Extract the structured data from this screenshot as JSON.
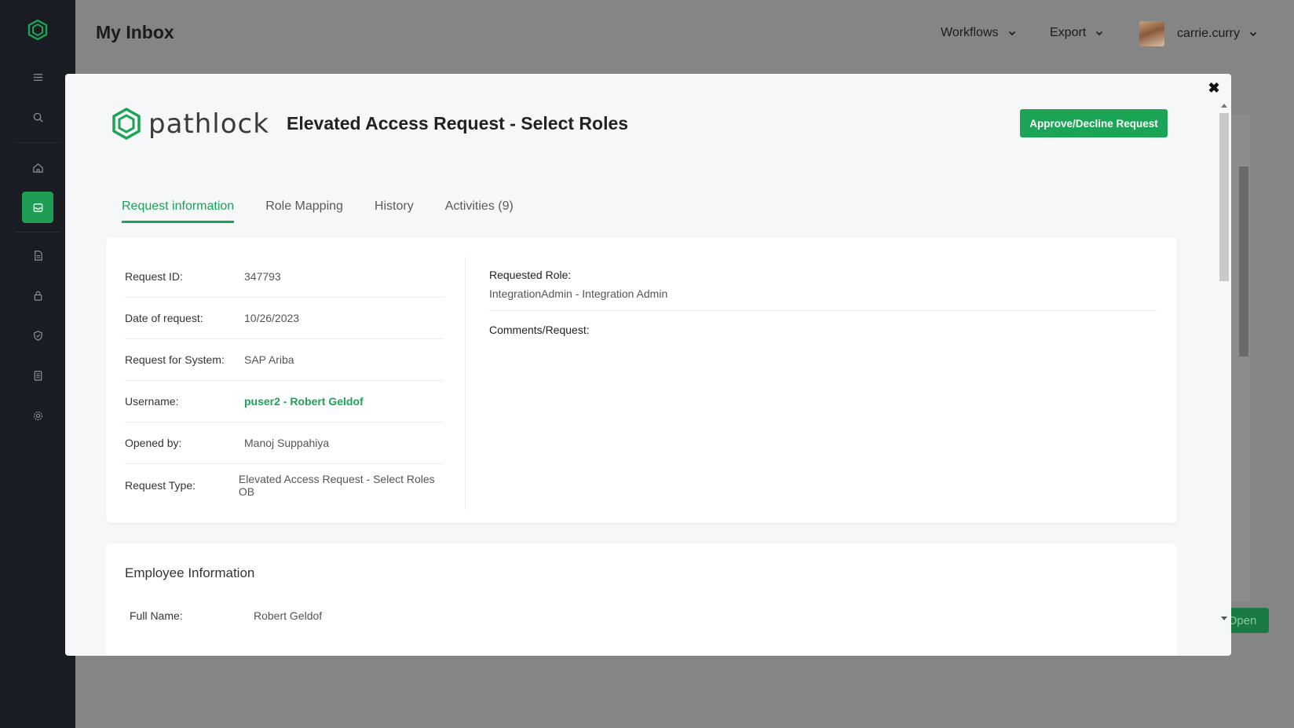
{
  "app": {
    "page_title": "My Inbox",
    "menu": {
      "workflows": "Workflows",
      "export": "Export",
      "user": "carrie.curry"
    },
    "background_button": "Open"
  },
  "sidebar": {
    "items": [
      {
        "icon": "menu-icon"
      },
      {
        "icon": "search-icon"
      },
      {
        "icon": "home-icon"
      },
      {
        "icon": "inbox-icon",
        "active": true
      },
      {
        "icon": "document-icon"
      },
      {
        "icon": "lock-icon"
      },
      {
        "icon": "shield-icon"
      },
      {
        "icon": "report-icon"
      },
      {
        "icon": "settings-icon"
      }
    ]
  },
  "modal": {
    "brand": "pathlock",
    "title": "Elevated Access Request - Select Roles",
    "approve_label": "Approve/Decline Request",
    "close_label": "✖",
    "tabs": [
      {
        "label": "Request information",
        "active": true
      },
      {
        "label": "Role Mapping"
      },
      {
        "label": "History"
      },
      {
        "label": "Activities (9)"
      }
    ],
    "request_info": {
      "fields": [
        {
          "label": "Request ID:",
          "value": "347793"
        },
        {
          "label": "Date of request:",
          "value": "10/26/2023"
        },
        {
          "label": "Request for System:",
          "value": "SAP Ariba"
        },
        {
          "label": "Username:",
          "value": "puser2 - Robert Geldof",
          "link": true
        },
        {
          "label": "Opened by:",
          "value": "Manoj Suppahiya"
        },
        {
          "label": "Request Type:",
          "value": "Elevated Access Request - Select Roles OB"
        }
      ],
      "requested_role_label": "Requested Role:",
      "requested_role_value": "IntegrationAdmin - Integration Admin",
      "comments_label": "Comments/Request:"
    },
    "employee_info": {
      "heading": "Employee Information",
      "full_name_label": "Full Name:",
      "full_name_value": "Robert Geldof"
    }
  },
  "colors": {
    "accent": "#1ba455",
    "sidebar_bg": "#1a1c23",
    "overlay": "#858585"
  }
}
